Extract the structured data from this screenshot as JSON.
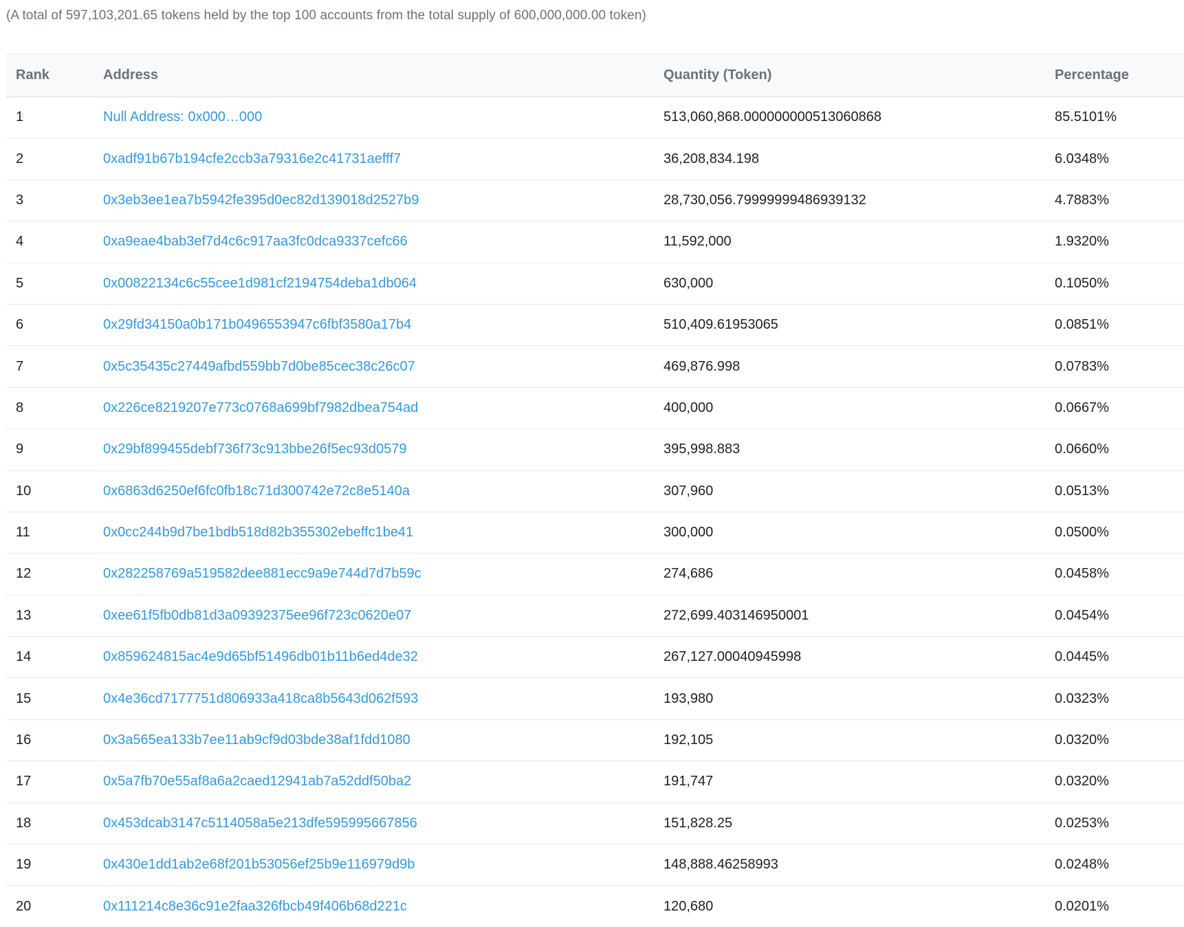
{
  "summary": "(A total of 597,103,201.65 tokens held by the top 100 accounts from the total supply of 600,000,000.00 token)",
  "table": {
    "headers": {
      "rank": "Rank",
      "address": "Address",
      "quantity": "Quantity (Token)",
      "percentage": "Percentage"
    },
    "rows": [
      {
        "rank": "1",
        "address": "Null Address: 0x000…000",
        "quantity": "513,060,868.000000000513060868",
        "percentage": "85.5101%"
      },
      {
        "rank": "2",
        "address": "0xadf91b67b194cfe2ccb3a79316e2c41731aefff7",
        "quantity": "36,208,834.198",
        "percentage": "6.0348%"
      },
      {
        "rank": "3",
        "address": "0x3eb3ee1ea7b5942fe395d0ec82d139018d2527b9",
        "quantity": "28,730,056.79999999486939132",
        "percentage": "4.7883%"
      },
      {
        "rank": "4",
        "address": "0xa9eae4bab3ef7d4c6c917aa3fc0dca9337cefc66",
        "quantity": "11,592,000",
        "percentage": "1.9320%"
      },
      {
        "rank": "5",
        "address": "0x00822134c6c55cee1d981cf2194754deba1db064",
        "quantity": "630,000",
        "percentage": "0.1050%"
      },
      {
        "rank": "6",
        "address": "0x29fd34150a0b171b0496553947c6fbf3580a17b4",
        "quantity": "510,409.61953065",
        "percentage": "0.0851%"
      },
      {
        "rank": "7",
        "address": "0x5c35435c27449afbd559bb7d0be85cec38c26c07",
        "quantity": "469,876.998",
        "percentage": "0.0783%"
      },
      {
        "rank": "8",
        "address": "0x226ce8219207e773c0768a699bf7982dbea754ad",
        "quantity": "400,000",
        "percentage": "0.0667%"
      },
      {
        "rank": "9",
        "address": "0x29bf899455debf736f73c913bbe26f5ec93d0579",
        "quantity": "395,998.883",
        "percentage": "0.0660%"
      },
      {
        "rank": "10",
        "address": "0x6863d6250ef6fc0fb18c71d300742e72c8e5140a",
        "quantity": "307,960",
        "percentage": "0.0513%"
      },
      {
        "rank": "11",
        "address": "0x0cc244b9d7be1bdb518d82b355302ebeffc1be41",
        "quantity": "300,000",
        "percentage": "0.0500%"
      },
      {
        "rank": "12",
        "address": "0x282258769a519582dee881ecc9a9e744d7d7b59c",
        "quantity": "274,686",
        "percentage": "0.0458%"
      },
      {
        "rank": "13",
        "address": "0xee61f5fb0db81d3a09392375ee96f723c0620e07",
        "quantity": "272,699.403146950001",
        "percentage": "0.0454%"
      },
      {
        "rank": "14",
        "address": "0x859624815ac4e9d65bf51496db01b11b6ed4de32",
        "quantity": "267,127.00040945998",
        "percentage": "0.0445%"
      },
      {
        "rank": "15",
        "address": "0x4e36cd7177751d806933a418ca8b5643d062f593",
        "quantity": "193,980",
        "percentage": "0.0323%"
      },
      {
        "rank": "16",
        "address": "0x3a565ea133b7ee11ab9cf9d03bde38af1fdd1080",
        "quantity": "192,105",
        "percentage": "0.0320%"
      },
      {
        "rank": "17",
        "address": "0x5a7fb70e55af8a6a2caed12941ab7a52ddf50ba2",
        "quantity": "191,747",
        "percentage": "0.0320%"
      },
      {
        "rank": "18",
        "address": "0x453dcab3147c5114058a5e213dfe595995667856",
        "quantity": "151,828.25",
        "percentage": "0.0253%"
      },
      {
        "rank": "19",
        "address": "0x430e1dd1ab2e68f201b53056ef25b9e116979d9b",
        "quantity": "148,888.46258993",
        "percentage": "0.0248%"
      },
      {
        "rank": "20",
        "address": "0x111214c8e36c91e2faa326fbcb49f406b68d221c",
        "quantity": "120,680",
        "percentage": "0.0201%"
      }
    ]
  },
  "colors": {
    "link": "#3498db",
    "header_text": "#6b7178",
    "border": "#e7eaf3",
    "body_text": "#1e2022"
  }
}
